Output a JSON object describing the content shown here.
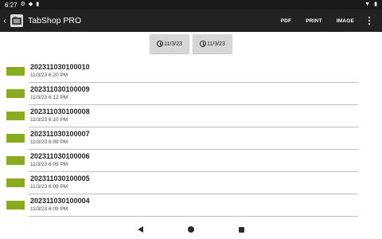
{
  "status_bar": {
    "time": "6:27",
    "icons": [
      "gear-icon",
      "shield-icon",
      "sd-card-icon",
      "wifi-icon",
      "battery-icon"
    ]
  },
  "app_bar": {
    "title": "TabShop PRO",
    "actions": [
      "PDF",
      "PRINT",
      "IMAGE"
    ]
  },
  "date_filters": {
    "from": "11/3/23",
    "to": "11/3/23"
  },
  "colors": {
    "app_bar": "#222222",
    "status_bar": "#1a1a1a",
    "swatch": "#8aaa1f",
    "date_button": "#d6d6d6"
  },
  "receipts": [
    {
      "id": "202311030100010",
      "date": "11/3/23 6:20 PM"
    },
    {
      "id": "202311030100009",
      "date": "11/3/23 6:12 PM"
    },
    {
      "id": "202311030100008",
      "date": "11/3/23 6:10 PM"
    },
    {
      "id": "202311030100007",
      "date": "11/3/23 6:09 PM"
    },
    {
      "id": "202311030100006",
      "date": "11/3/23 6:09 PM"
    },
    {
      "id": "202311030100005",
      "date": "11/3/23 6:09 PM"
    },
    {
      "id": "202311030100004",
      "date": "11/3/23 6:09 PM"
    }
  ]
}
